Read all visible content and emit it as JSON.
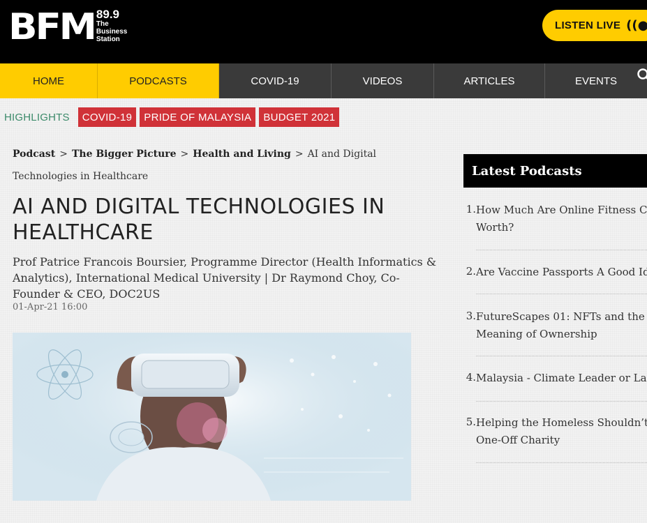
{
  "header": {
    "logo_main": "BFM",
    "logo_frequency": "89.9",
    "logo_tagline_1": "The",
    "logo_tagline_2": "Business",
    "logo_tagline_3": "Station",
    "listen_label": "LISTEN LIVE",
    "listen_icon": "radio-broadcast-icon"
  },
  "nav": {
    "items": [
      {
        "label": "HOME"
      },
      {
        "label": "PODCASTS"
      },
      {
        "label": "COVID-19"
      },
      {
        "label": "VIDEOS"
      },
      {
        "label": "ARTICLES"
      },
      {
        "label": "EVENTS"
      }
    ],
    "search_icon": "search-icon"
  },
  "highlights": {
    "label": "HIGHLIGHTS",
    "tags": [
      "COVID-19",
      "PRIDE OF MALAYSIA",
      "BUDGET 2021"
    ]
  },
  "breadcrumb": {
    "items": [
      "Podcast",
      "The Bigger Picture",
      "Health and Living"
    ],
    "current": "AI and Digital Technologies in Healthcare",
    "separator": ">"
  },
  "article": {
    "title": "AI AND DIGITAL TECHNOLOGIES IN HEALTHCARE",
    "byline": "Prof Patrice Francois Boursier, Programme Director (Health Informatics & Analytics), International Medical University | Dr Raymond Choy, Co-Founder & CEO, DOC2US",
    "date": "01-Apr-21 16:00",
    "image_alt": "Person wearing a VR headset with medical holograms"
  },
  "sidebar": {
    "heading": "Latest Podcasts",
    "items": [
      {
        "num": "1.",
        "line1": "How Much Are Online Fitness Classes",
        "line2": "Worth?"
      },
      {
        "num": "2.",
        "line1": "Are Vaccine Passports A Good Idea?",
        "line2": ""
      },
      {
        "num": "3.",
        "line1": "FutureScapes 01: NFTs and the",
        "line2": "Meaning of Ownership"
      },
      {
        "num": "4.",
        "line1": "Malaysia - Climate Leader or Laggard?",
        "line2": ""
      },
      {
        "num": "5.",
        "line1": "Helping the Homeless Shouldn’t Be",
        "line2": "One-Off Charity"
      }
    ]
  },
  "colors": {
    "brand_yellow": "#ffcc00",
    "highlight_red": "#d03238",
    "highlight_green": "#3b8a6a",
    "nav_dark": "#3a3a3a"
  }
}
